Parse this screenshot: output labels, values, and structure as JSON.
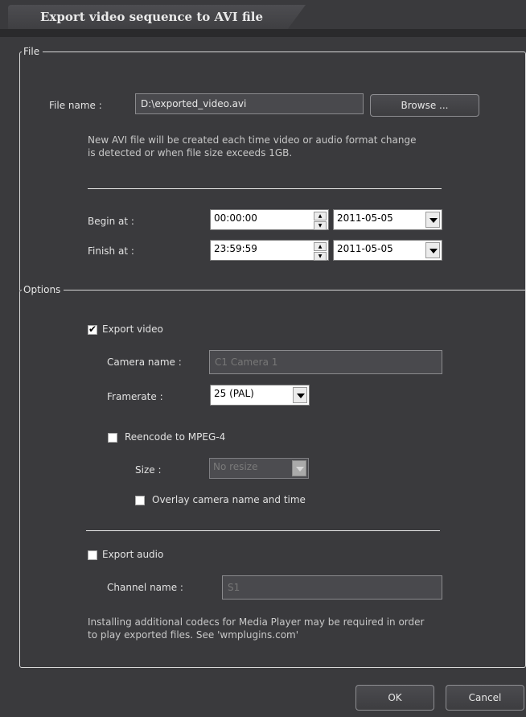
{
  "window": {
    "title": "Export video sequence to AVI file"
  },
  "file_group": {
    "legend": "File",
    "file_name_label": "File name :",
    "file_name_value": "D:\\exported_video.avi",
    "browse_label": "Browse ...",
    "info_text_1": "New AVI file will be created each time video or audio format change",
    "info_text_2": "is detected or when file size exceeds 1GB.",
    "begin_label": "Begin at :",
    "begin_time": "00:00:00",
    "begin_date": "2011-05-05",
    "finish_label": "Finish at :",
    "finish_time": "23:59:59",
    "finish_date": "2011-05-05"
  },
  "options_group": {
    "legend": "Options",
    "export_video": {
      "label": "Export video",
      "checked": true
    },
    "camera_name_label": "Camera name :",
    "camera_name_value": "C1 Camera 1",
    "framerate_label": "Framerate :",
    "framerate_value": "25 (PAL)",
    "reencode": {
      "label": "Reencode to MPEG-4",
      "checked": false
    },
    "size_label": "Size :",
    "size_value": "No resize",
    "overlay": {
      "label": "Overlay camera name and time",
      "checked": false
    },
    "export_audio": {
      "label": "Export audio",
      "checked": false
    },
    "channel_name_label": "Channel name :",
    "channel_name_value": "S1",
    "note_1": "Installing additional codecs for Media Player may be required in order",
    "note_2": "to play exported files. See 'wmplugins.com'"
  },
  "buttons": {
    "ok": "OK",
    "cancel": "Cancel"
  }
}
